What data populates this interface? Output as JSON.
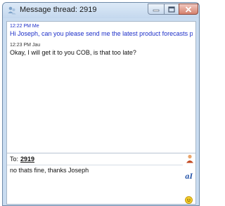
{
  "window": {
    "title": "Message thread: 2919"
  },
  "messages": [
    {
      "time": "12:22 PM",
      "sender": "Me",
      "meta": "12:22 PM Me",
      "text": "Hi Joseph, can you please send me the latest product forecasts pls"
    },
    {
      "time": "12:23 PM",
      "sender": "Jau",
      "meta": "12:23 PM Jau",
      "text": "Okay, I will get it to you COB, is that too late?"
    }
  ],
  "recipient": {
    "label": "To:",
    "value": "2919"
  },
  "compose": {
    "text": "no thats fine, thanks Joseph"
  },
  "icons": {
    "title": "people-icon",
    "person": "person-icon",
    "font": "font-icon",
    "smiley": "smiley-icon"
  },
  "colors": {
    "my_message": "#1c2ec8",
    "their_message": "#111111",
    "window_frame": "#c9dcf0"
  }
}
